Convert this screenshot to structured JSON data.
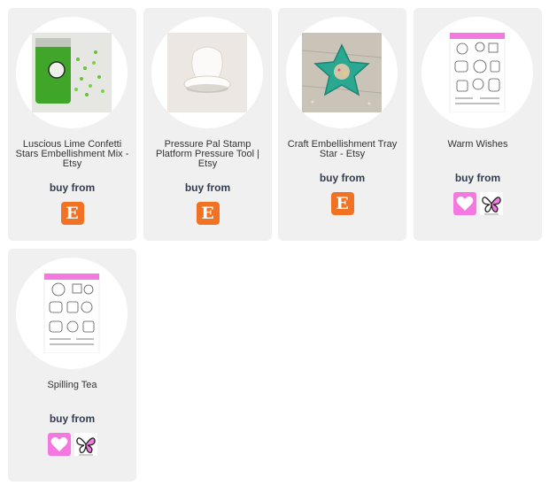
{
  "products": [
    {
      "title": "Luscious Lime Confetti Stars Embellishment Mix - Etsy",
      "buy_label": "buy from",
      "retailer": "Etsy",
      "etsy_letter": "E",
      "image": "lime-confetti-bag-image"
    },
    {
      "title": "Pressure Pal Stamp Platform Pressure Tool | Etsy",
      "buy_label": "buy from",
      "retailer": "Etsy",
      "etsy_letter": "E",
      "image": "pressure-tool-image"
    },
    {
      "title": "Craft Embellishment Tray Star - Etsy",
      "buy_label": "buy from",
      "retailer": "Etsy",
      "etsy_letter": "E",
      "image": "star-tray-image"
    },
    {
      "title": "Warm Wishes",
      "buy_label": "buy from",
      "retailers": [
        "heart-shop",
        "butterfly-shop"
      ],
      "image": "stamp-set-image"
    },
    {
      "title": "Spilling Tea",
      "buy_label": "buy from",
      "retailers": [
        "heart-shop",
        "butterfly-shop"
      ],
      "image": "stamp-set-image"
    }
  ],
  "colors": {
    "card_bg": "#f0f0f0",
    "etsy_orange": "#f27224",
    "heart_pink": "#f578e0",
    "buy_text": "#333d4f"
  }
}
